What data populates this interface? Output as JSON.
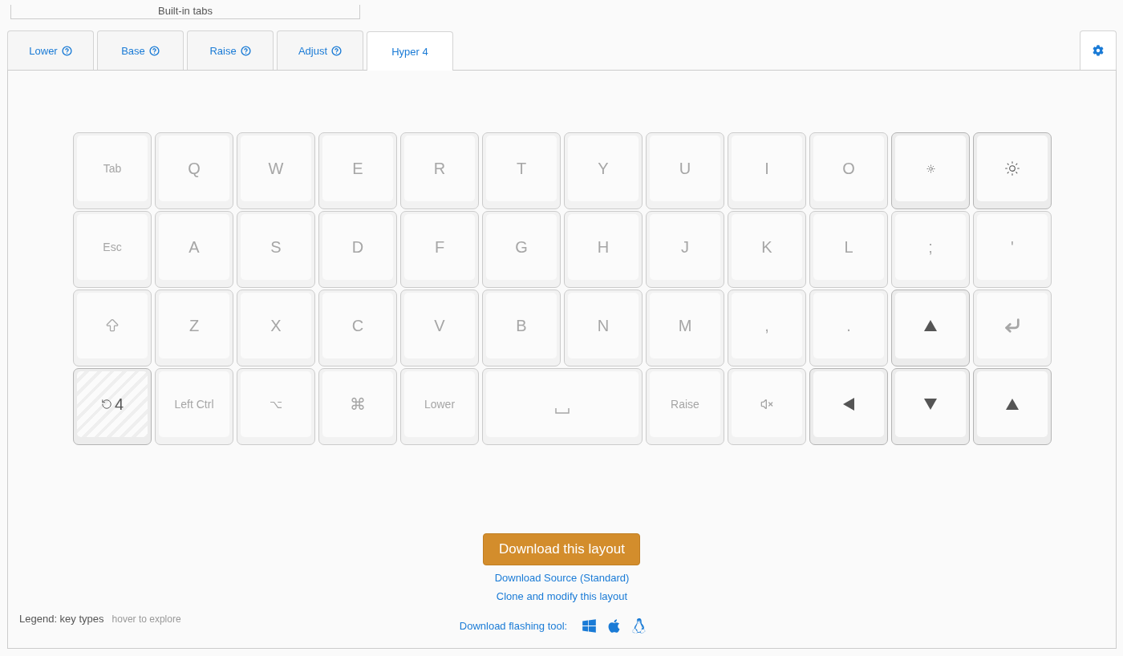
{
  "tab_group_label": "Built-in tabs",
  "tabs": [
    {
      "label": "Lower",
      "help": true,
      "selected": false
    },
    {
      "label": "Base",
      "help": true,
      "selected": false
    },
    {
      "label": "Raise",
      "help": true,
      "selected": false
    },
    {
      "label": "Adjust",
      "help": true,
      "selected": false
    },
    {
      "label": "Hyper 4",
      "help": false,
      "selected": true
    }
  ],
  "keyboard": {
    "rows": [
      {
        "keys": [
          {
            "kind": "word",
            "label": "Tab",
            "active": false
          },
          {
            "kind": "text",
            "label": "Q",
            "active": false
          },
          {
            "kind": "text",
            "label": "W",
            "active": false
          },
          {
            "kind": "text",
            "label": "E",
            "active": false
          },
          {
            "kind": "text",
            "label": "R",
            "active": false
          },
          {
            "kind": "text",
            "label": "T",
            "active": false
          },
          {
            "kind": "text",
            "label": "Y",
            "active": false
          },
          {
            "kind": "text",
            "label": "U",
            "active": false
          },
          {
            "kind": "text",
            "label": "I",
            "active": false
          },
          {
            "kind": "text",
            "label": "O",
            "active": false
          },
          {
            "kind": "dim",
            "active": true
          },
          {
            "kind": "bright",
            "active": true
          }
        ]
      },
      {
        "keys": [
          {
            "kind": "word",
            "label": "Esc",
            "active": false
          },
          {
            "kind": "text",
            "label": "A",
            "active": false
          },
          {
            "kind": "text",
            "label": "S",
            "active": false
          },
          {
            "kind": "text",
            "label": "D",
            "active": false
          },
          {
            "kind": "text",
            "label": "F",
            "active": false
          },
          {
            "kind": "text",
            "label": "G",
            "active": false
          },
          {
            "kind": "text",
            "label": "H",
            "active": false
          },
          {
            "kind": "text",
            "label": "J",
            "active": false
          },
          {
            "kind": "text",
            "label": "K",
            "active": false
          },
          {
            "kind": "text",
            "label": "L",
            "active": false
          },
          {
            "kind": "text",
            "label": ";",
            "active": false
          },
          {
            "kind": "text",
            "label": "'",
            "active": false
          }
        ]
      },
      {
        "keys": [
          {
            "kind": "shift",
            "active": false
          },
          {
            "kind": "text",
            "label": "Z",
            "active": false
          },
          {
            "kind": "text",
            "label": "X",
            "active": false
          },
          {
            "kind": "text",
            "label": "C",
            "active": false
          },
          {
            "kind": "text",
            "label": "V",
            "active": false
          },
          {
            "kind": "text",
            "label": "B",
            "active": false
          },
          {
            "kind": "text",
            "label": "N",
            "active": false
          },
          {
            "kind": "text",
            "label": "M",
            "active": false
          },
          {
            "kind": "text",
            "label": ",",
            "active": false
          },
          {
            "kind": "text",
            "label": ".",
            "active": false
          },
          {
            "kind": "up",
            "active": true
          },
          {
            "kind": "enter",
            "active": false
          }
        ]
      },
      {
        "keys": [
          {
            "kind": "layer",
            "label": "4",
            "active": true
          },
          {
            "kind": "word",
            "label": "Left Ctrl",
            "active": false
          },
          {
            "kind": "word",
            "label": "⌥",
            "active": false
          },
          {
            "kind": "text",
            "label": "⌘",
            "active": false
          },
          {
            "kind": "word",
            "label": "Lower",
            "active": false
          },
          {
            "kind": "space",
            "active": false
          },
          {
            "kind": "word",
            "label": "Raise",
            "active": false
          },
          {
            "kind": "mute",
            "active": false
          },
          {
            "kind": "left",
            "active": true
          },
          {
            "kind": "down",
            "active": true
          },
          {
            "kind": "up",
            "active": true
          }
        ]
      }
    ]
  },
  "download_button": "Download this layout",
  "links": [
    "Download Source (Standard)",
    "Clone and modify this layout"
  ],
  "flashing_tool_label": "Download flashing tool:",
  "legend": {
    "title": "Legend: key types",
    "hint": "hover to explore"
  }
}
